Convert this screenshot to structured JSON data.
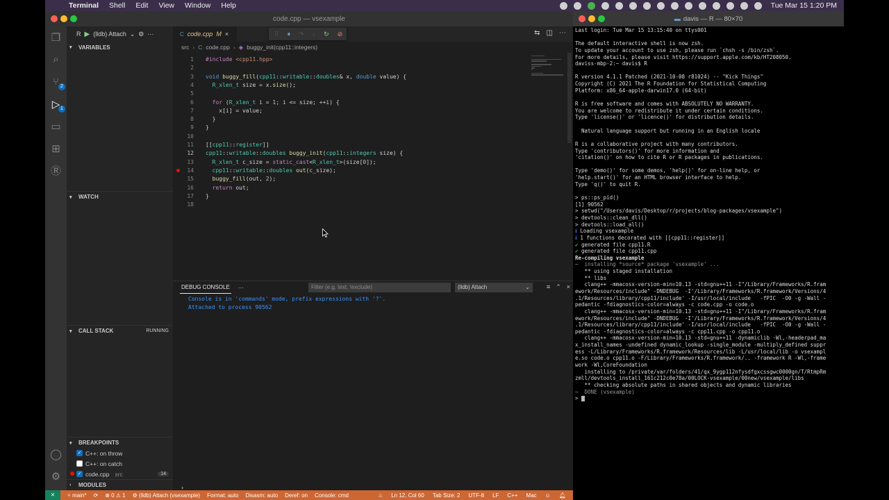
{
  "menubar": {
    "app": "Terminal",
    "items": [
      "Shell",
      "Edit",
      "View",
      "Window",
      "Help"
    ],
    "clock": "Tue Mar 15  1:20 PM"
  },
  "vscode": {
    "window_title": "code.cpp — vsexample",
    "debug_toolbar": {
      "config": "(lldb) Attach"
    },
    "sections": {
      "variables": "VARIABLES",
      "watch": "WATCH",
      "call_stack": "CALL STACK",
      "call_stack_state": "RUNNING",
      "breakpoints": "BREAKPOINTS",
      "modules": "MODULES"
    },
    "breakpoints": [
      {
        "label": "C++: on throw",
        "checked": true
      },
      {
        "label": "C++: on catch",
        "checked": false
      },
      {
        "label": "code.cpp",
        "dir": "src",
        "count": "14",
        "checked": true
      }
    ],
    "tab": {
      "name": "code.cpp",
      "modified": "M",
      "icon": "C"
    },
    "breadcrumb": {
      "folder": "src",
      "file": "code.cpp",
      "symbol": "buggy_init(cpp11::integers)"
    },
    "code_lines": [
      {
        "n": "1",
        "text": "#include <cpp11.hpp>"
      },
      {
        "n": "2",
        "text": ""
      },
      {
        "n": "3",
        "text": "void buggy_fill(cpp11::writable::doubles& x, double value) {"
      },
      {
        "n": "4",
        "text": "  R_xlen_t size = x.size();"
      },
      {
        "n": "5",
        "text": ""
      },
      {
        "n": "6",
        "text": "  for (R_xlen_t i = 1; i <= size; ++i) {"
      },
      {
        "n": "7",
        "text": "    x[i] = value;"
      },
      {
        "n": "8",
        "text": "  }"
      },
      {
        "n": "9",
        "text": "}"
      },
      {
        "n": "10",
        "text": ""
      },
      {
        "n": "11",
        "text": "[[cpp11::register]]"
      },
      {
        "n": "12",
        "text": "cpp11::writable::doubles buggy_init(cpp11::integers size) {"
      },
      {
        "n": "13",
        "text": "  R_xlen_t c_size = static_cast<R_xlen_t>(size[0]);"
      },
      {
        "n": "14",
        "text": "  cpp11::writable::doubles out(c_size);"
      },
      {
        "n": "15",
        "text": "  buggy_fill(out, 2);"
      },
      {
        "n": "16",
        "text": "  return out;"
      },
      {
        "n": "17",
        "text": "}"
      },
      {
        "n": "18",
        "text": ""
      }
    ],
    "panel": {
      "tab": "DEBUG CONSOLE",
      "filter_placeholder": "Filter (e.g. text, !exclude)",
      "select_value": "(lldb) Attach",
      "lines": [
        "Console is in 'commands' mode, prefix expressions with '?'.",
        "Attached to process 90562"
      ]
    },
    "status": {
      "branch": "main*",
      "problems": "⊗ 0 ⚠ 1",
      "debug": "(lldb) Attach (vsexample)",
      "format": "Format: auto",
      "disasm": "Disasm: auto",
      "deref": "Deref: on",
      "console": "Console: cmd",
      "position": "Ln 12, Col 60",
      "tabsize": "Tab Size: 2",
      "encoding": "UTF-8",
      "eol": "LF",
      "language": "C++",
      "platform": "Mac"
    }
  },
  "terminal": {
    "title": "davis — R — 80×70",
    "lines": [
      "Last login: Tue Mar 15 13:15:40 on ttys001",
      "",
      "The default interactive shell is now zsh.",
      "To update your account to use zsh, please run `chsh -s /bin/zsh`.",
      "For more details, please visit https://support.apple.com/kb/HT208050.",
      "daviss-mbp-2:~ davis$ R",
      "",
      "R version 4.1.1 Patched (2021-10-08 r81024) -- \"Kick Things\"",
      "Copyright (C) 2021 The R Foundation for Statistical Computing",
      "Platform: x86_64-apple-darwin17.0 (64-bit)",
      "",
      "R is free software and comes with ABSOLUTELY NO WARRANTY.",
      "You are welcome to redistribute it under certain conditions.",
      "Type 'license()' or 'licence()' for distribution details.",
      "",
      "  Natural language support but running in an English locale",
      "",
      "R is a collaborative project with many contributors.",
      "Type 'contributors()' for more information and",
      "'citation()' on how to cite R or R packages in publications.",
      "",
      "Type 'demo()' for some demos, 'help()' for on-line help, or",
      "'help.start()' for an HTML browser interface to help.",
      "Type 'q()' to quit R.",
      "",
      "> ps::ps_pid()",
      "[1] 90562",
      "> setwd(\"/Users/davis/Desktop/r/projects/blog-packages/vsexample\")",
      "> devtools::clean_dll()",
      "> devtools::load_all()",
      "ℹ Loading vsexample",
      "ℹ 1 functions decorated with [[cpp11::register]]",
      "✔ generated file cpp11.R",
      "✔ generated file cpp11.cpp",
      "Re-compiling vsexample",
      "─  installing *source* package 'vsexample' ...",
      "   ** using staged installation",
      "   ** libs",
      "   clang++ -mmacosx-version-min=10.13 -std=gnu++11 -I\"/Library/Frameworks/R.fram",
      "ework/Resources/include\" -DNDEBUG  -I'/Library/Frameworks/R.framework/Versions/4",
      ".1/Resources/library/cpp11/include' -I/usr/local/include   -fPIC  -O0 -g -Wall -",
      "pedantic -fdiagnostics-color=always -c code.cpp -o code.o",
      "   clang++ -mmacosx-version-min=10.13 -std=gnu++11 -I\"/Library/Frameworks/R.fram",
      "ework/Resources/include\" -DNDEBUG  -I'/Library/Frameworks/R.framework/Versions/4",
      ".1/Resources/library/cpp11/include' -I/usr/local/include   -fPIC  -O0 -g -Wall -",
      "pedantic -fdiagnostics-color=always -c cpp11.cpp -o cpp11.o",
      "   clang++ -mmacosx-version-min=10.13 -std=gnu++11 -dynamiclib -Wl,-headerpad_ma",
      "x_install_names -undefined dynamic_lookup -single_module -multiply_defined suppr",
      "ess -L/Library/Frameworks/R.framework/Resources/lib -L/usr/local/lib -o vsexampl",
      "e.so code.o cpp11.o -F/Library/Frameworks/R.framework/.. -framework R -Wl,-frame",
      "work -Wl,CoreFoundation",
      "   installing to /private/var/folders/41/qx_9ygp112nfysdfgxcssgwc0000gn/T/RtmpRm",
      "zmll/devtools_install_161c212c0e78a/00LOCK-vsexample/00new/vsexample/libs",
      "   ** checking absolute paths in shared objects and dynamic libraries",
      "─  DONE (vsexample)",
      "> "
    ]
  }
}
